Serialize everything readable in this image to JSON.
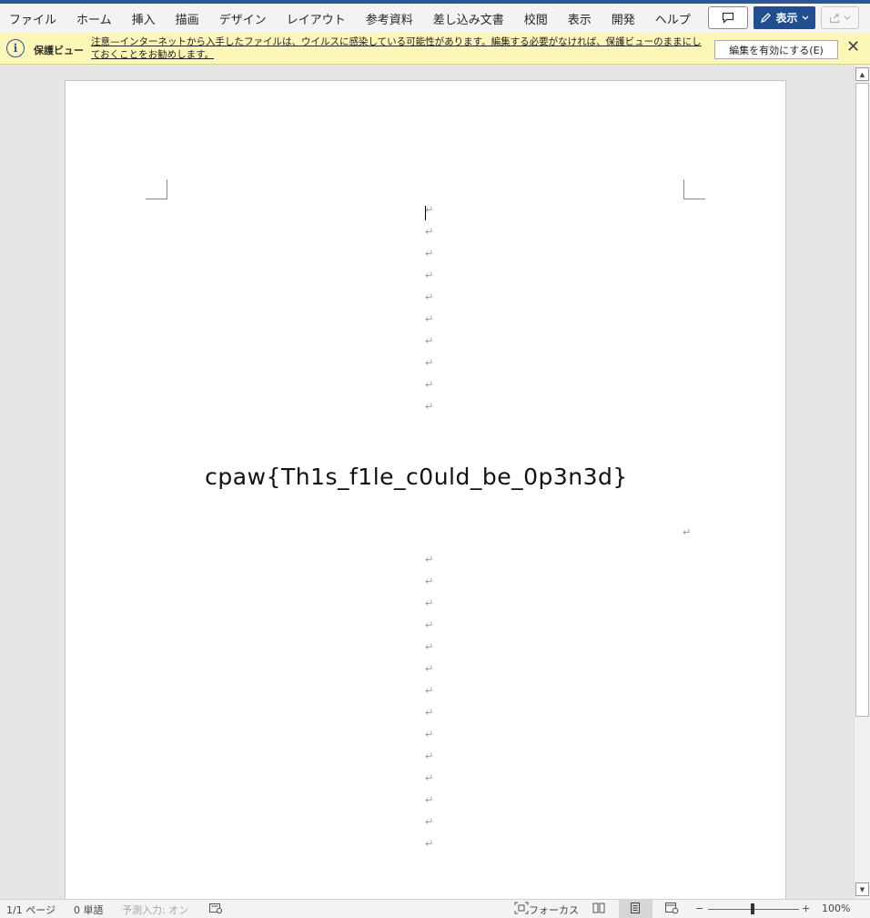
{
  "ribbon": {
    "tabs": [
      "ファイル",
      "ホーム",
      "挿入",
      "描画",
      "デザイン",
      "レイアウト",
      "参考資料",
      "差し込み文書",
      "校閲",
      "表示",
      "開発",
      "ヘルプ"
    ],
    "view_button": "表示",
    "accent": "#2b579a"
  },
  "infobar": {
    "title": "保護ビュー",
    "message": "注意—インターネットから入手したファイルは、ウイルスに感染している可能性があります。編集する必要がなければ、保護ビューのままにしておくことをお勧めします。",
    "enable_button": "編集を有効にする(E)",
    "close": "✕",
    "background": "#fcf7b6"
  },
  "document": {
    "paragraph_mark": "↵",
    "flag_text": "cpaw{Th1s_f1le_c0uld_be_0p3n3d}"
  },
  "status": {
    "pages": "1/1 ページ",
    "words": "0 単語",
    "ime": "予測入力: オン",
    "focus": "フォーカス",
    "zoom_minus": "−",
    "zoom_plus": "+",
    "zoom": "100%"
  }
}
